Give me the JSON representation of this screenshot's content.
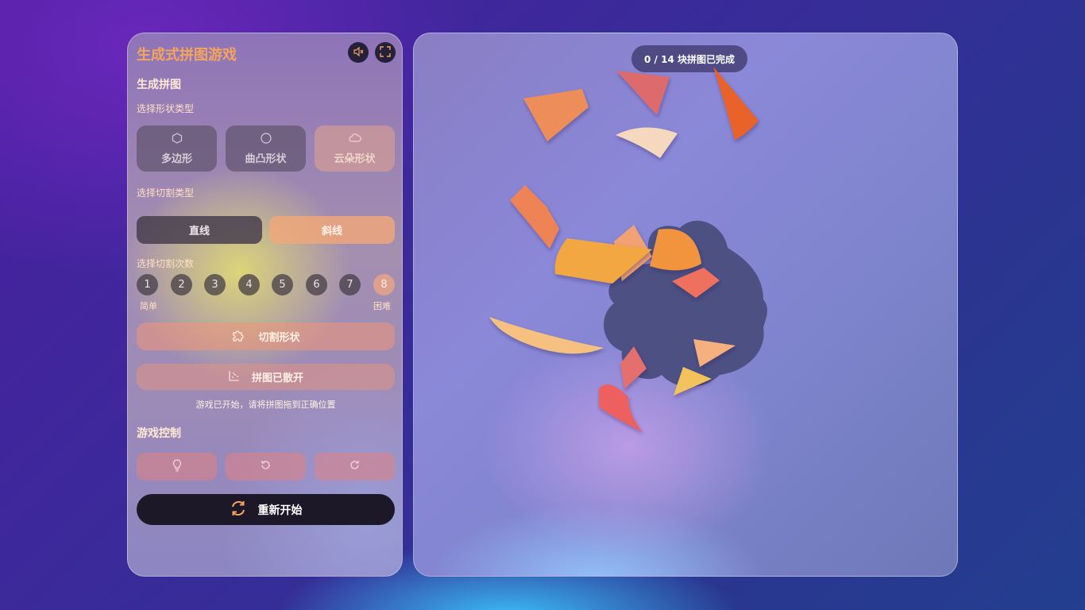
{
  "panel": {
    "title": "生成式拼图游戏",
    "generate_heading": "生成拼图",
    "shape_type_label": "选择形状类型",
    "shape_types": [
      {
        "label": "多边形",
        "icon": "hexagon-icon"
      },
      {
        "label": "曲凸形状",
        "icon": "circle-icon"
      },
      {
        "label": "云朵形状",
        "icon": "cloud-icon"
      }
    ],
    "cut_type_label": "选择切割类型",
    "cut_types": [
      {
        "label": "直线"
      },
      {
        "label": "斜线"
      }
    ],
    "cut_count_label": "选择切割次数",
    "cut_counts": [
      "1",
      "2",
      "3",
      "4",
      "5",
      "6",
      "7",
      "8"
    ],
    "selected_cut_count": "8",
    "easy_label": "简单",
    "hard_label": "困难",
    "cut_button_label": "切割形状",
    "scatter_button_label": "拼图已散开",
    "status_text": "游戏已开始，请将拼图拖到正确位置",
    "controls_heading": "游戏控制",
    "restart_label": "重新开始"
  },
  "board": {
    "progress_text": "0 / 14 块拼图已完成",
    "pieces_completed": 0,
    "pieces_total": 14
  },
  "colors": {
    "accent": "#f6a35e",
    "restart_bg": "#1d1828",
    "target_shape": "#4a4d7e"
  }
}
